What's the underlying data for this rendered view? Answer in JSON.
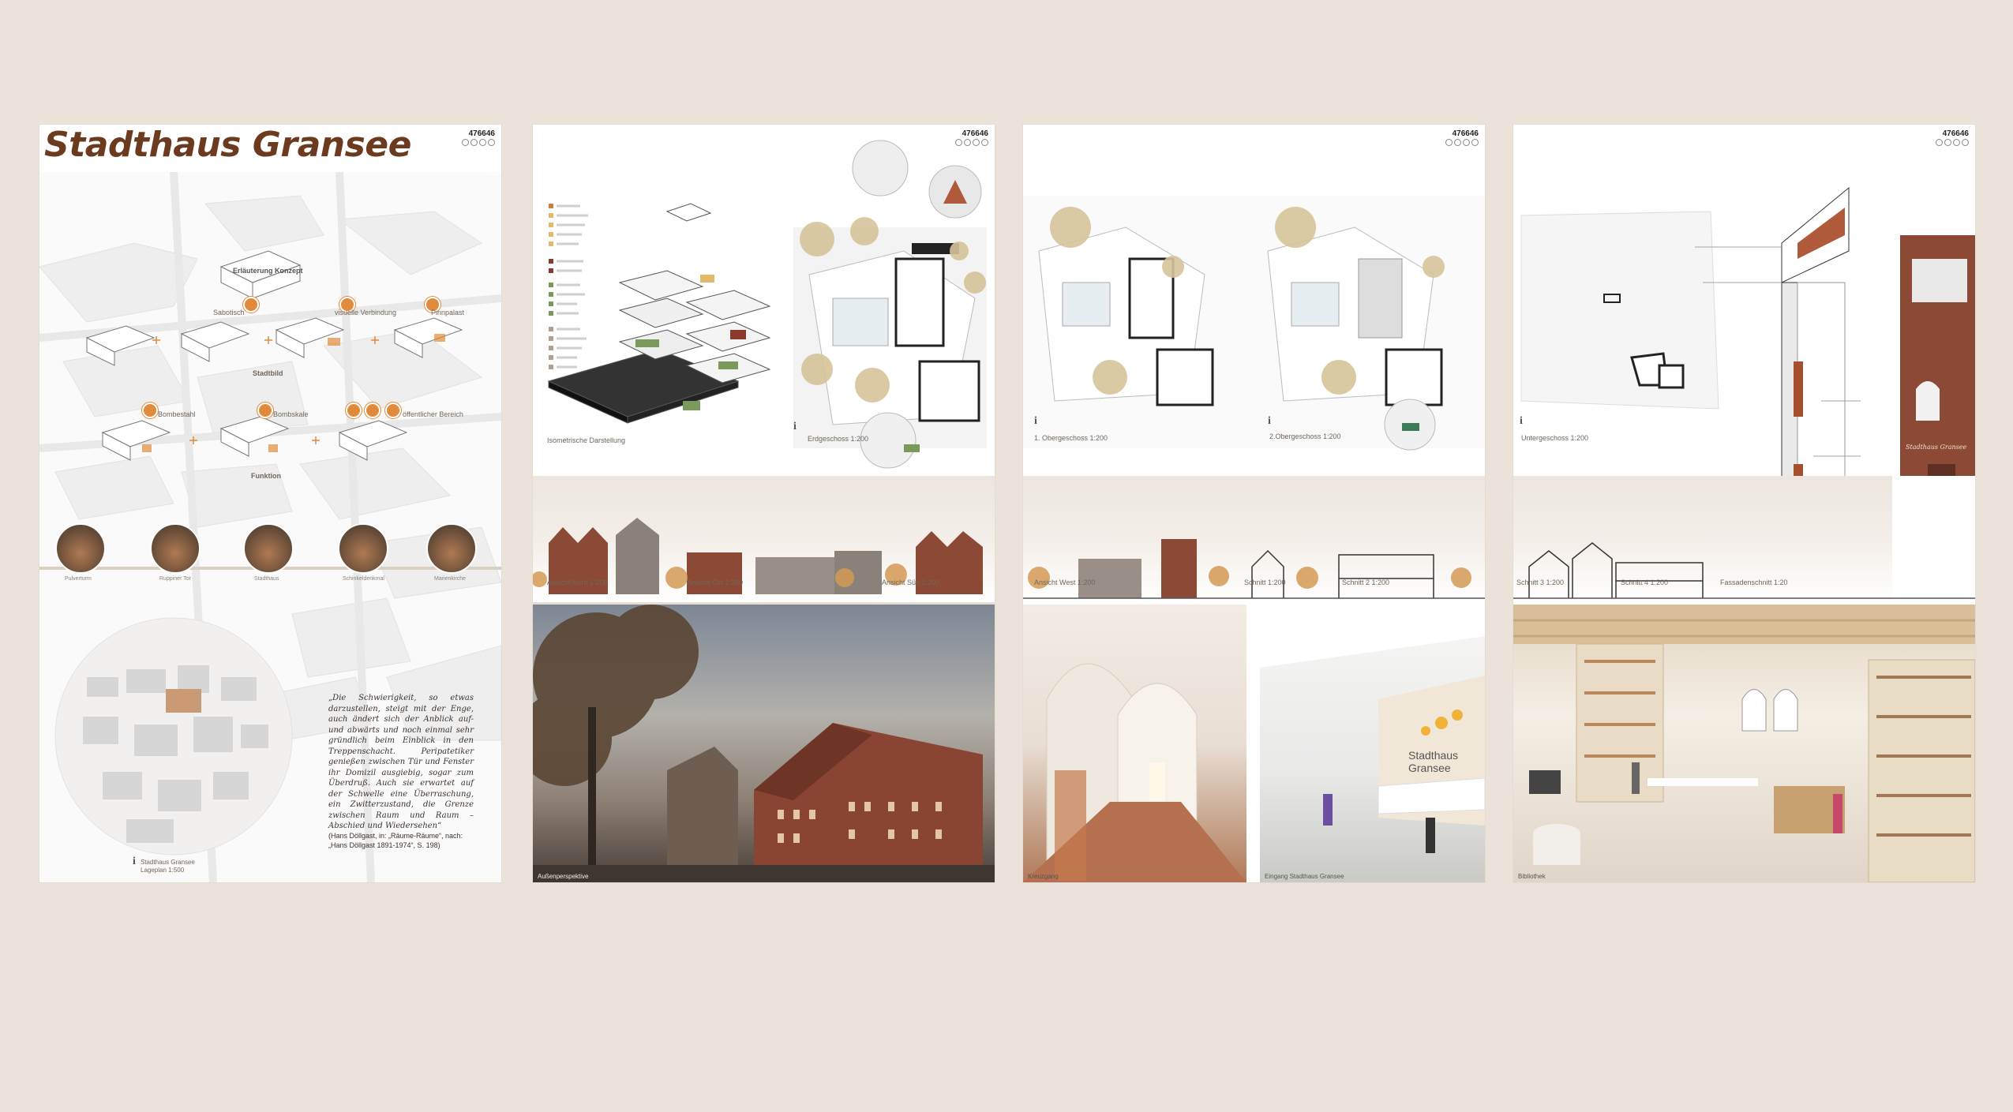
{
  "panel_id": "476646",
  "panel1": {
    "title": "Stadthaus Gransee",
    "concept_heading": "Erläuterung Konzept",
    "concepts": [
      "Sabotisch",
      "visuelle Verbindung",
      "Pinnpalast",
      "Stadtbild",
      "Bombestahl",
      "Bombskale",
      "öffentlicher Bereich",
      "Funktion"
    ],
    "photo_captions": [
      "Pulverturm",
      "Ruppiner Tor",
      "Stadthaus",
      "Schinkeldenkmal",
      "Marienkirche"
    ],
    "quote": "„Die Schwierigkeit, so etwas darzustellen, steigt mit der Enge, auch ändert sich der Anblick auf- und abwärts und noch einmal sehr gründlich beim Einblick in den Treppenschacht. Peripatetiker genießen zwischen Tür und Fenster ihr Domizil ausgiebig, sogar zum Überdruß. Auch sie erwartet auf der Schwelle eine Überraschung, ein Zwitterzustand, die Grenze zwischen Raum und Raum – Abschied und Wiedersehen“",
    "quote_source": "(Hans Döllgast, in: „Räume-Räume“, nach: „Hans Döllgast 1891-1974“, S. 198)",
    "circle_caption": "Stadthaus Gransee\nLageplan 1:500"
  },
  "panel2": {
    "isometric_label": "Isometrische Darstellung",
    "plan_label": "Erdgeschoss 1:200",
    "elevations": [
      "Ansicht Nord 1:200",
      "Ansicht Ost 1:200",
      "Ansicht Süd 1:200"
    ],
    "render_caption": "Außenperspektive"
  },
  "panel3": {
    "plans": [
      "1. Obergeschoss 1:200",
      "2.Obergeschoss 1:200"
    ],
    "elevations": [
      "Ansicht West 1:200",
      "Schnitt 1:200",
      "Schnitt 2 1:200"
    ],
    "render_captions": [
      "Kreuzgang",
      "Eingang Stadthaus Gransee"
    ]
  },
  "panel4": {
    "plan_label": "Untergeschoss 1:200",
    "elevations": [
      "Schnitt 3 1:200",
      "Schnitt 4 1:200",
      "Fassadenschnitt 1:20"
    ],
    "facade_sign": "Stadthaus Gransee",
    "render_caption": "Bibliothek"
  },
  "colors": {
    "background": "#ebe3da",
    "title": "#6b3a1f",
    "accent": "#e08a3c",
    "brick": "#8c4a36"
  }
}
